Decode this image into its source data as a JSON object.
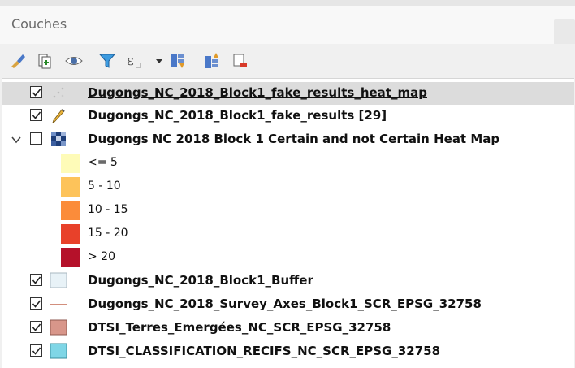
{
  "panel": {
    "title": "Couches"
  },
  "toolbar": {
    "buttons": [
      {
        "icon": "style-brush-icon"
      },
      {
        "icon": "add-group-icon"
      },
      {
        "icon": "visibility-eye-icon"
      },
      {
        "icon": "filter-icon"
      },
      {
        "icon": "expression-filter-icon"
      },
      {
        "icon": "dropdown-arrow-icon"
      },
      {
        "icon": "expand-all-icon"
      },
      {
        "icon": "collapse-all-icon"
      },
      {
        "icon": "remove-layer-icon"
      }
    ]
  },
  "layers": [
    {
      "name": "Dugongs_NC_2018_Block1_fake_results_heat_map",
      "checked": true,
      "selected": true,
      "underlined": true,
      "symbol": "point-dots-icon"
    },
    {
      "name": "Dugongs_NC_2018_Block1_fake_results [29]",
      "checked": true,
      "selected": false,
      "underlined": false,
      "symbol": "pencil-edit-icon"
    },
    {
      "name": "Dugongs NC 2018 Block 1 Certain and not Certain Heat Map",
      "checked": false,
      "expanded": true,
      "symbol": "raster-heatmap-icon"
    },
    {
      "name": "Dugongs_NC_2018_Block1_Buffer",
      "checked": true,
      "symbol": "polygon-swatch",
      "color": "#e8f2f7"
    },
    {
      "name": "Dugongs_NC_2018_Survey_Axes_Block1_SCR_EPSG_32758",
      "checked": true,
      "symbol": "line-swatch",
      "color": "#c46a52"
    },
    {
      "name": "DTSI_Terres_Emergées_NC_SCR_EPSG_32758",
      "checked": true,
      "symbol": "polygon-swatch",
      "color": "#d8968a"
    },
    {
      "name": "DTSI_CLASSIFICATION_RECIFS_NC_SCR_EPSG_32758",
      "checked": true,
      "symbol": "polygon-swatch",
      "color": "#7fd6e6"
    }
  ],
  "legend": [
    {
      "label": "<= 5",
      "color": "#fefbb8"
    },
    {
      "label": "5 - 10",
      "color": "#fdc35a"
    },
    {
      "label": "10 - 15",
      "color": "#fb8c3a"
    },
    {
      "label": "15 - 20",
      "color": "#e8412a"
    },
    {
      "label": "> 20",
      "color": "#b5112a"
    }
  ]
}
